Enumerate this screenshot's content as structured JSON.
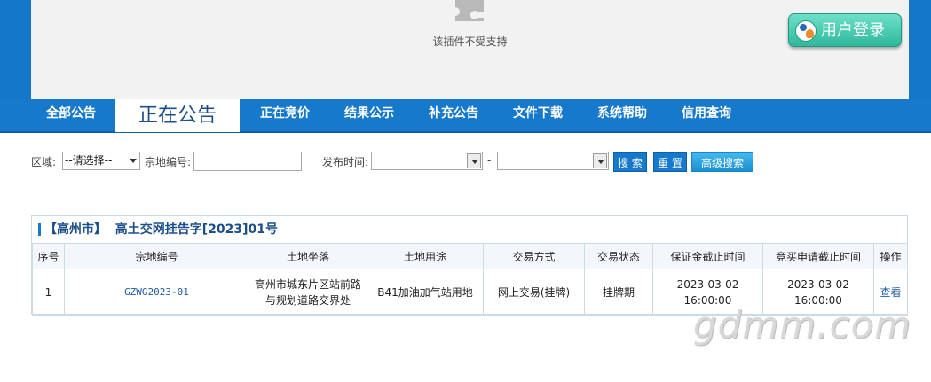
{
  "banner": {
    "plugin_message": "该插件不受支持",
    "plugin_icon": "puzzle-piece-icon",
    "login_label": "用户登录",
    "login_icon": "users-avatar-icon",
    "colors": {
      "nav_blue": "#1679cc",
      "login_green": "#2fb89b"
    }
  },
  "nav": {
    "items": [
      {
        "label": "全部公告"
      },
      {
        "label": "正在公告"
      },
      {
        "label": "正在竞价"
      },
      {
        "label": "结果公示"
      },
      {
        "label": "补充公告"
      },
      {
        "label": "文件下载"
      },
      {
        "label": "系统帮助"
      },
      {
        "label": "信用查询"
      }
    ],
    "active": "正在公告"
  },
  "search": {
    "region_label": "区域:",
    "region_value": "--请选择--",
    "parcel_label": "宗地编号:",
    "parcel_value": "",
    "date_label": "发布时间:",
    "date_sep": "-",
    "date_from": "",
    "date_to": "",
    "search_btn": "搜 索",
    "reset_btn": "重 置",
    "advanced_btn": "高级搜索"
  },
  "panel": {
    "region_tag": "【高州市】",
    "notice_no": "高土交网挂告字[2023]01号",
    "columns": [
      "序号",
      "宗地编号",
      "土地坐落",
      "土地用途",
      "交易方式",
      "交易状态",
      "保证金截止时间",
      "竞买申请截止时间",
      "操作"
    ],
    "rows": [
      {
        "seq": "1",
        "code": "GZWG2023-01",
        "location_line1": "高州市城东片区站前路",
        "location_line2": "与规划道路交界处",
        "usage": "B41加油加气站用地",
        "method": "网上交易(挂牌)",
        "status": "挂牌期",
        "deposit_deadline": "2023-03-02 16:00:00",
        "apply_deadline": "2023-03-02 16:00:00",
        "action": "查看"
      }
    ]
  },
  "watermark": "gdmm.com"
}
